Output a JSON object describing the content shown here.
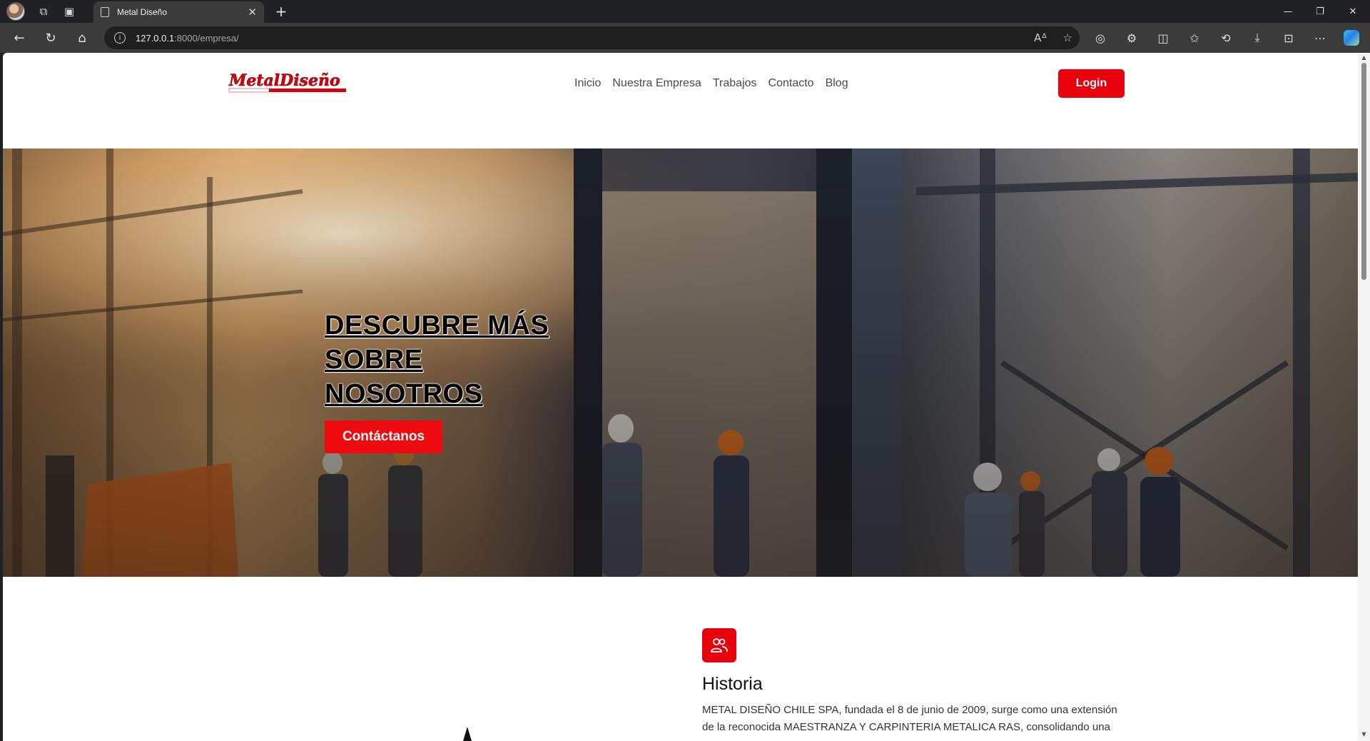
{
  "browser": {
    "tab_title": "Metal Diseño",
    "url_host": "127.0.0.1",
    "url_path": ":8000/empresa/"
  },
  "site": {
    "logo_text": "MetalDiseño",
    "logo_tagline": "La nueva imagen de los permanentes",
    "nav": [
      {
        "label": "Inicio"
      },
      {
        "label": "Nuestra Empresa"
      },
      {
        "label": "Trabajos"
      },
      {
        "label": "Contacto"
      },
      {
        "label": "Blog"
      }
    ],
    "login_label": "Login"
  },
  "hero": {
    "title_lines": [
      "DESCUBRE MÁS",
      "SOBRE",
      "NOSOTROS"
    ],
    "button_label": "Contáctanos"
  },
  "history": {
    "icon": "users-icon",
    "title": "Historia",
    "text_lines": [
      "METAL DISEÑO CHILE SPA, fundada el 8 de junio de 2009, surge como una extensión",
      "de la reconocida MAESTRANZA Y CARPINTERIA METALICA RAS, consolidando una"
    ]
  },
  "colors": {
    "accent": "#e8000b",
    "chrome_dark": "#202124",
    "chrome_toolbar": "#3b3b3b"
  }
}
